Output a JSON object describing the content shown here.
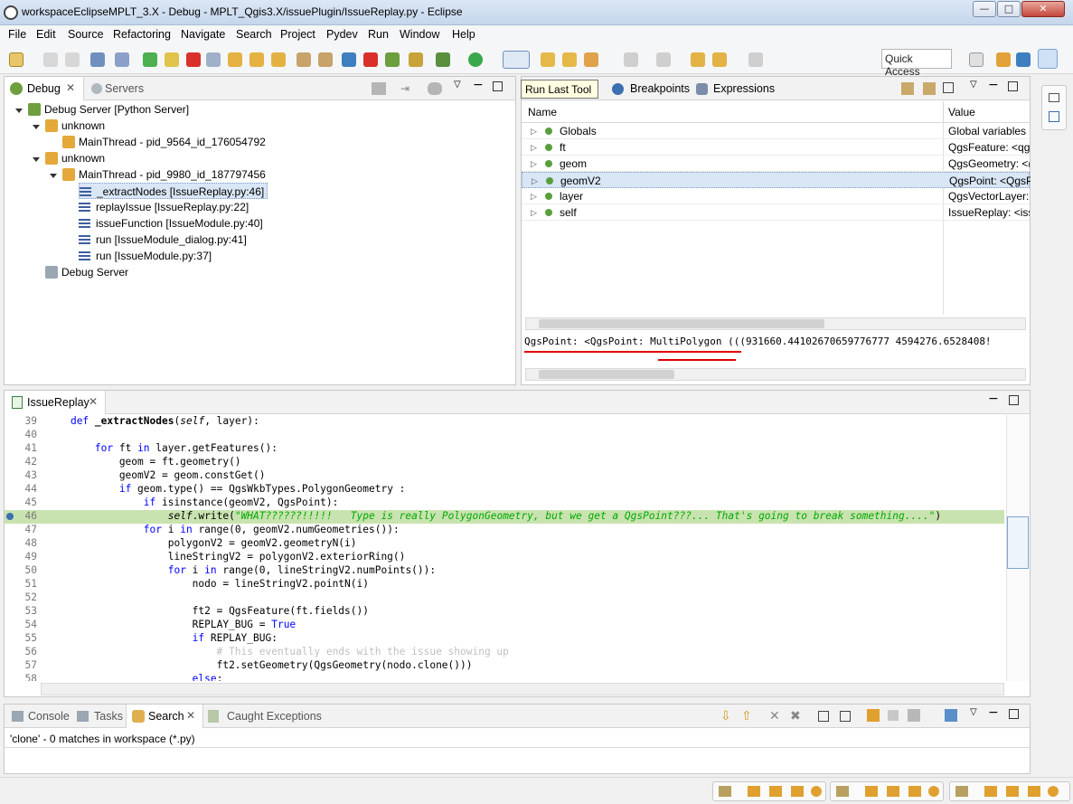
{
  "window": {
    "title": "workspaceEclipseMPLT_3.X - Debug - MPLT_Qgis3.X/issuePlugin/IssueReplay.py - Eclipse"
  },
  "menu": [
    "File",
    "Edit",
    "Source",
    "Refactoring",
    "Navigate",
    "Search",
    "Project",
    "Pydev",
    "Run",
    "Window",
    "Help"
  ],
  "toolbar": {
    "quick_access": "Quick Access",
    "tooltip": "Run Last Tool"
  },
  "debug_view": {
    "tabs": [
      "Debug",
      "Servers"
    ],
    "tree": [
      "Debug Server [Python Server]",
      "unknown",
      "MainThread - pid_9564_id_176054792",
      "unknown",
      "MainThread - pid_9980_id_187797456",
      "_extractNodes [IssueReplay.py:46]",
      "replayIssue [IssueReplay.py:22]",
      "issueFunction [IssueModule.py:40]",
      "run [IssueModule_dialog.py:41]",
      "run [IssueModule.py:37]",
      "Debug Server"
    ]
  },
  "variables_view": {
    "tabs": [
      "Breakpoints",
      "Expressions"
    ],
    "columns": [
      "Name",
      "Value"
    ],
    "rows": [
      {
        "name": "Globals",
        "value": "Global variables"
      },
      {
        "name": "ft",
        "value": "QgsFeature: <qg"
      },
      {
        "name": "geom",
        "value": "QgsGeometry: <("
      },
      {
        "name": "geomV2",
        "value": "QgsPoint: <QgsP"
      },
      {
        "name": "layer",
        "value": "QgsVectorLayer:"
      },
      {
        "name": "self",
        "value": "IssueReplay: <iss"
      }
    ],
    "detail": "QgsPoint: <QgsPoint: MultiPolygon (((931660.44102670659776777 4594276.6528408!"
  },
  "editor": {
    "tab": "IssueReplay",
    "lines": [
      {
        "n": "39",
        "t": "    def _extractNodes(self, layer):"
      },
      {
        "n": "40",
        "t": ""
      },
      {
        "n": "41",
        "t": "        for ft in layer.getFeatures():"
      },
      {
        "n": "42",
        "t": "            geom = ft.geometry()"
      },
      {
        "n": "43",
        "t": "            geomV2 = geom.constGet()"
      },
      {
        "n": "44",
        "t": "            if geom.type() == QgsWkbTypes.PolygonGeometry :"
      },
      {
        "n": "45",
        "t": "                if isinstance(geomV2, QgsPoint):"
      },
      {
        "n": "46",
        "t": "                    self.write(\"WHAT??????!!!!!   Type is really PolygonGeometry, but we get a QgsPoint???... That's going to break something....\")"
      },
      {
        "n": "47",
        "t": "                for i in range(0, geomV2.numGeometries()):"
      },
      {
        "n": "48",
        "t": "                    polygonV2 = geomV2.geometryN(i)"
      },
      {
        "n": "49",
        "t": "                    lineStringV2 = polygonV2.exteriorRing()"
      },
      {
        "n": "50",
        "t": "                    for i in range(0, lineStringV2.numPoints()):"
      },
      {
        "n": "51",
        "t": "                        nodo = lineStringV2.pointN(i)"
      },
      {
        "n": "52",
        "t": ""
      },
      {
        "n": "53",
        "t": "                        ft2 = QgsFeature(ft.fields())"
      },
      {
        "n": "54",
        "t": "                        REPLAY_BUG = True"
      },
      {
        "n": "55",
        "t": "                        if REPLAY_BUG:"
      },
      {
        "n": "56",
        "t": "                            # This eventually ends with the issue showing up"
      },
      {
        "n": "57",
        "t": "                            ft2.setGeometry(QgsGeometry(nodo.clone()))"
      },
      {
        "n": "58",
        "t": "                        else:"
      }
    ]
  },
  "bottom_view": {
    "tabs": [
      "Console",
      "Tasks",
      "Search",
      "Caught Exceptions"
    ],
    "result": "'clone' - 0 matches in workspace (*.py)"
  }
}
